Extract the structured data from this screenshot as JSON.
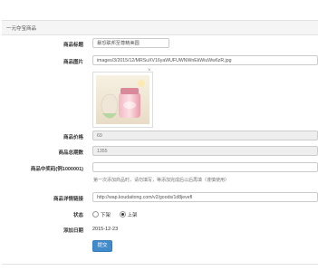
{
  "panel": {
    "title": "一元夺宝商品"
  },
  "form": {
    "title": {
      "label": "商品标题",
      "value": "暴恐联邦至尊精美圆"
    },
    "image": {
      "label": "商品图片",
      "value": "images/3/2015/12/MRSuXV16yaWUFUWNWnEkWiuWw6zR.jpg",
      "close": "×"
    },
    "price": {
      "label": "商品价格",
      "value": "69"
    },
    "total": {
      "label": "商品总期数",
      "value": "1355"
    },
    "winner": {
      "label": "商品中奖码(例1000001)",
      "value": "",
      "hint": "第一次添加商品时，请勿填写，等添加完成后以后再填（谨慎使用）"
    },
    "detail": {
      "label": "商品详情链接",
      "value": "http://wap.koudaitong.com/v2/goods/1d8jevefl"
    },
    "status": {
      "label": "状态",
      "options": [
        "下架",
        "上架"
      ],
      "selected": 1
    },
    "date": {
      "label": "添加日期",
      "value": "2015-12-23"
    },
    "submit_label": "提交"
  }
}
